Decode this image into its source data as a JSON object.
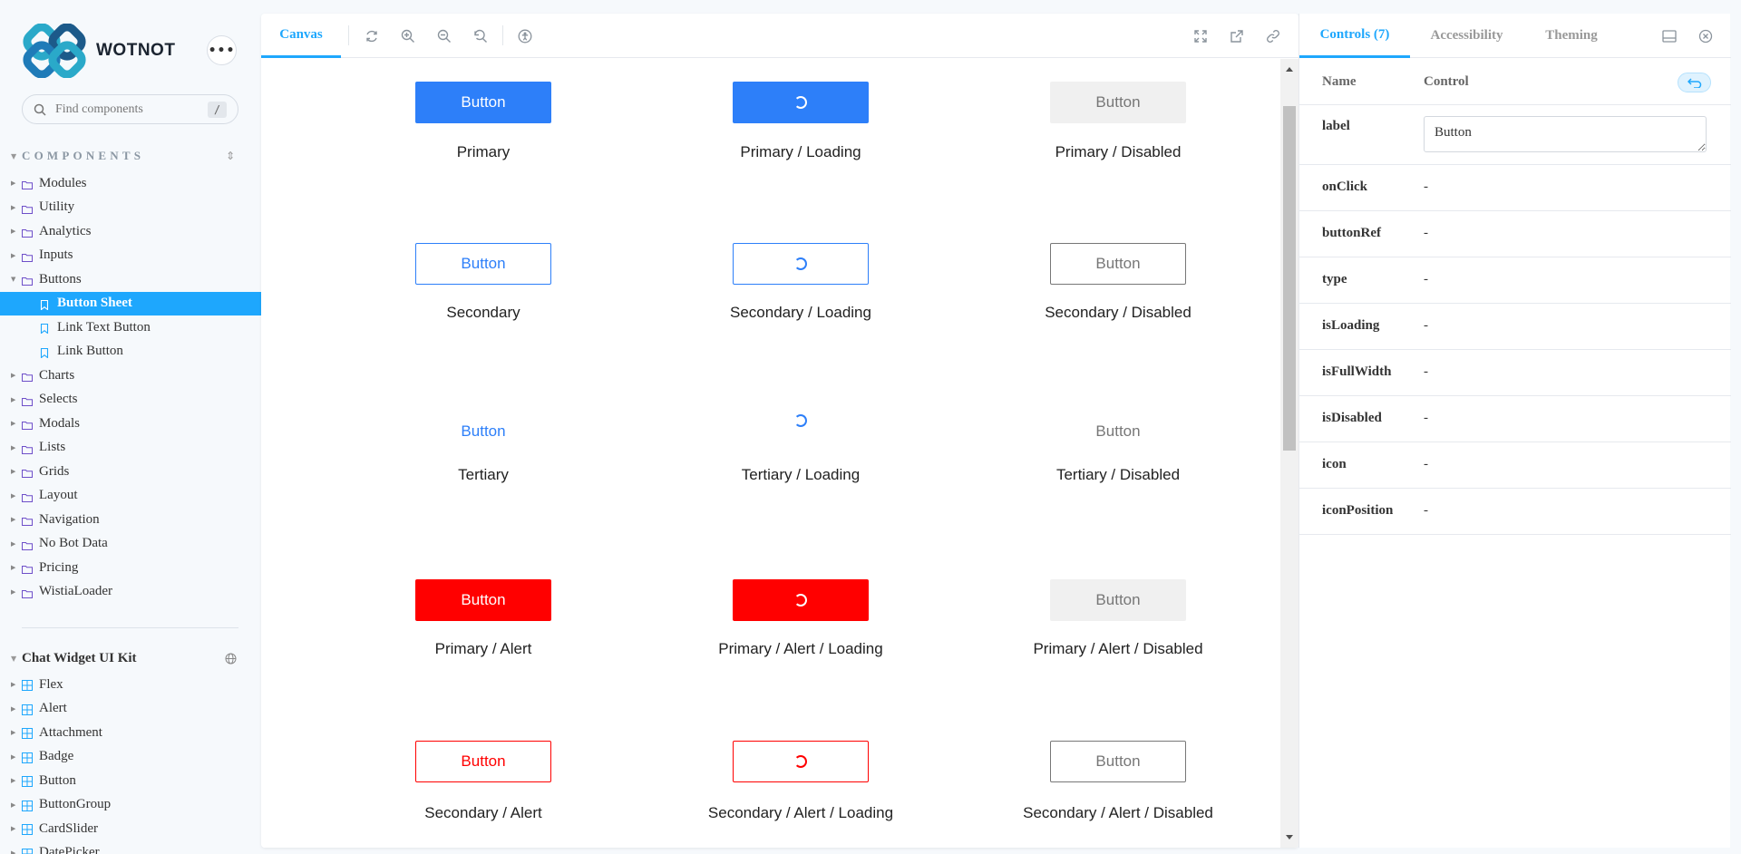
{
  "colors": {
    "accent": "#1ea7fd",
    "primary_button": "#2d7ff9",
    "alert_button": "#ff0000"
  },
  "sidebar": {
    "brand": "WOTNOT",
    "menu_icon": "more-horizontal-icon",
    "search": {
      "placeholder": "Find components",
      "shortcut": "/"
    },
    "components_title": "COMPONENTS",
    "tree": [
      {
        "label": "Modules"
      },
      {
        "label": "Utility"
      },
      {
        "label": "Analytics"
      },
      {
        "label": "Inputs"
      },
      {
        "label": "Buttons",
        "expanded": true
      },
      {
        "label": "Button Sheet",
        "child": true,
        "active": true
      },
      {
        "label": "Link Text Button",
        "child": true
      },
      {
        "label": "Link Button",
        "child": true
      },
      {
        "label": "Charts"
      },
      {
        "label": "Selects"
      },
      {
        "label": "Modals"
      },
      {
        "label": "Lists"
      },
      {
        "label": "Grids"
      },
      {
        "label": "Layout"
      },
      {
        "label": "Navigation"
      },
      {
        "label": "No Bot Data"
      },
      {
        "label": "Pricing"
      },
      {
        "label": "WistiaLoader"
      }
    ],
    "kit_title": "Chat Widget UI Kit",
    "kit_items": [
      {
        "label": "Flex"
      },
      {
        "label": "Alert"
      },
      {
        "label": "Attachment"
      },
      {
        "label": "Badge"
      },
      {
        "label": "Button"
      },
      {
        "label": "ButtonGroup"
      },
      {
        "label": "CardSlider"
      },
      {
        "label": "DatePicker"
      }
    ]
  },
  "canvas": {
    "tab_label": "Canvas",
    "toolbar_icons": [
      "reload-icon",
      "zoom-in-icon",
      "zoom-out-icon",
      "zoom-reset-icon",
      "accessibility-icon"
    ],
    "right_icons": [
      "fullscreen-icon",
      "open-new-tab-icon",
      "copy-link-icon"
    ],
    "buttons": [
      {
        "label": "Button",
        "caption": "Primary",
        "variant": "primary",
        "loading": false
      },
      {
        "label": "",
        "caption": "Primary / Loading",
        "variant": "primary",
        "loading": true
      },
      {
        "label": "Button",
        "caption": "Primary / Disabled",
        "variant": "disabled",
        "loading": false
      },
      {
        "label": "Button",
        "caption": "Secondary",
        "variant": "secondary",
        "loading": false
      },
      {
        "label": "",
        "caption": "Secondary / Loading",
        "variant": "secondary",
        "loading": true
      },
      {
        "label": "Button",
        "caption": "Secondary / Disabled",
        "variant": "sec-disabled",
        "loading": false
      },
      {
        "label": "Button",
        "caption": "Tertiary",
        "variant": "tertiary",
        "loading": false
      },
      {
        "label": "",
        "caption": "Tertiary / Loading",
        "variant": "tertiary",
        "loading": true
      },
      {
        "label": "Button",
        "caption": "Tertiary / Disabled",
        "variant": "tert-disabled",
        "loading": false
      },
      {
        "label": "Button",
        "caption": "Primary / Alert",
        "variant": "alert",
        "loading": false
      },
      {
        "label": "",
        "caption": "Primary / Alert / Loading",
        "variant": "alert",
        "loading": true
      },
      {
        "label": "Button",
        "caption": "Primary / Alert / Disabled",
        "variant": "disabled",
        "loading": false
      },
      {
        "label": "Button",
        "caption": "Secondary / Alert",
        "variant": "sec-alert",
        "loading": false
      },
      {
        "label": "",
        "caption": "Secondary / Alert / Loading",
        "variant": "sec-alert",
        "loading": true
      },
      {
        "label": "Button",
        "caption": "Secondary / Alert / Disabled",
        "variant": "sec-disabled",
        "loading": false
      }
    ]
  },
  "controls": {
    "tabs": [
      "Controls (7)",
      "Accessibility",
      "Theming"
    ],
    "header_name": "Name",
    "header_control": "Control",
    "rows": [
      {
        "name": "label",
        "value": "Button",
        "input": true
      },
      {
        "name": "onClick",
        "value": "-"
      },
      {
        "name": "buttonRef",
        "value": "-"
      },
      {
        "name": "type",
        "value": "-"
      },
      {
        "name": "isLoading",
        "value": "-"
      },
      {
        "name": "isFullWidth",
        "value": "-"
      },
      {
        "name": "isDisabled",
        "value": "-"
      },
      {
        "name": "icon",
        "value": "-"
      },
      {
        "name": "iconPosition",
        "value": "-"
      }
    ]
  }
}
